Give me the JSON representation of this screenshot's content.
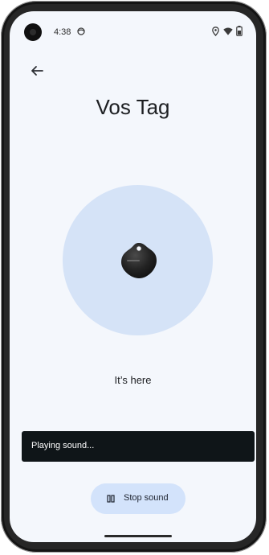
{
  "status_bar": {
    "time": "4:38",
    "icons": [
      "notification-face-icon",
      "location-icon",
      "wifi-icon",
      "battery-icon"
    ]
  },
  "header": {
    "back_icon": "arrow-left-icon",
    "title": "Vos Tag"
  },
  "device": {
    "image": "tracker-tag-icon",
    "status_text": "It’s here"
  },
  "snackbar": {
    "text": "Playing sound..."
  },
  "actions": {
    "stop_icon": "pause-icon",
    "stop_label": "Stop sound"
  },
  "colors": {
    "screen_background": "#f4f7fc",
    "circle": "#d5e3f7",
    "snackbar": "#0f1518",
    "button": "#d3e3fb"
  }
}
